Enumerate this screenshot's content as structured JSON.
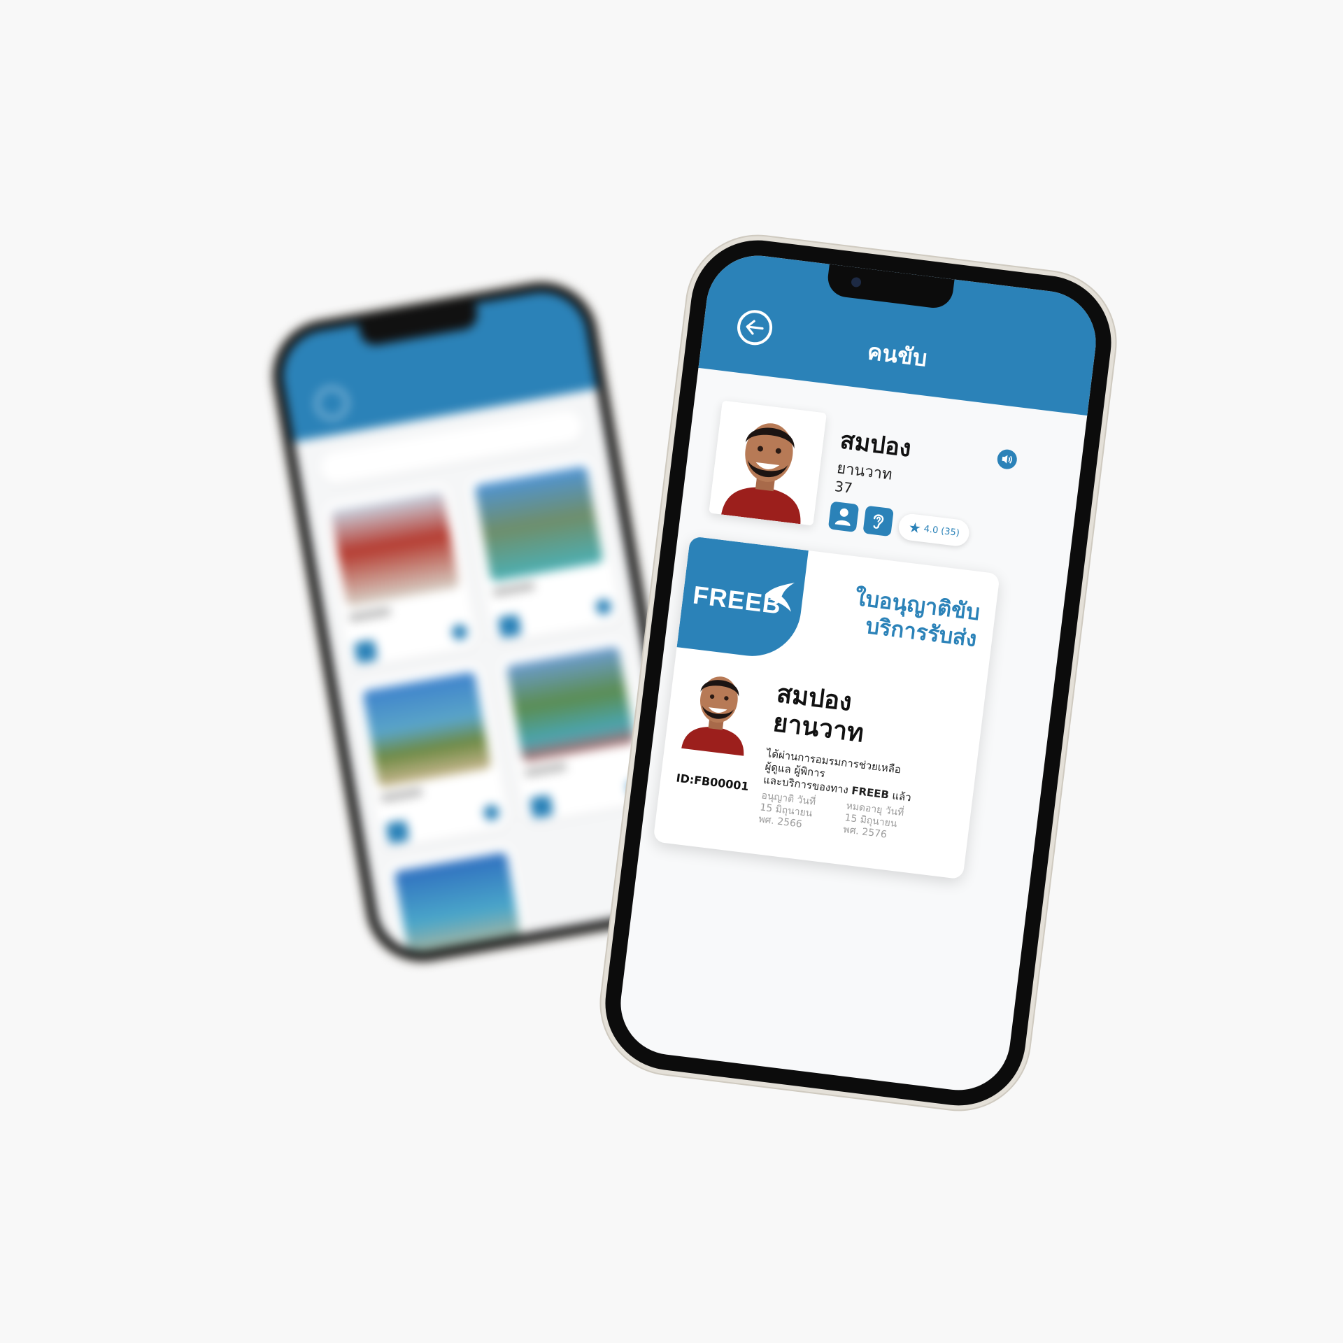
{
  "background_phone": {
    "title": "",
    "search_placeholder": "",
    "cards": 5
  },
  "header": {
    "title": "คนขับ",
    "back_icon": "arrow-left-circle-icon"
  },
  "driver": {
    "first_name": "สมปอง",
    "last_name": "ยานวาท",
    "age": "37",
    "rating": "4.0",
    "rating_count": "(35)",
    "badges": [
      "person-icon",
      "ear-icon"
    ],
    "speaker_icon": "speaker-icon"
  },
  "license": {
    "logo_text": "FREEB",
    "title_line1": "ใบอนุญาติขับ",
    "title_line2": "บริการรับส่ง",
    "name_line1": "สมปอง",
    "name_line2": "ยานวาท",
    "desc_line1": "ได้ผ่านการอมรมการช่วยเหลือ",
    "desc_line2": "ผู้ดูแล ผู้พิการ",
    "desc_line3": "และบริการของทาง ",
    "desc_brand": "FREEB",
    "desc_end": " แล้ว",
    "id": "ID:FB00001",
    "issued_label": "อนุญาติ วันที่",
    "issued_date": "15 มิถุนายน",
    "issued_year": "พศ. 2566",
    "expires_label": "หมดอายุ วันที่",
    "expires_date": "15 มิถุนายน",
    "expires_year": "พศ. 2576"
  },
  "colors": {
    "primary": "#2b82b8",
    "background": "#f8f8f8"
  }
}
